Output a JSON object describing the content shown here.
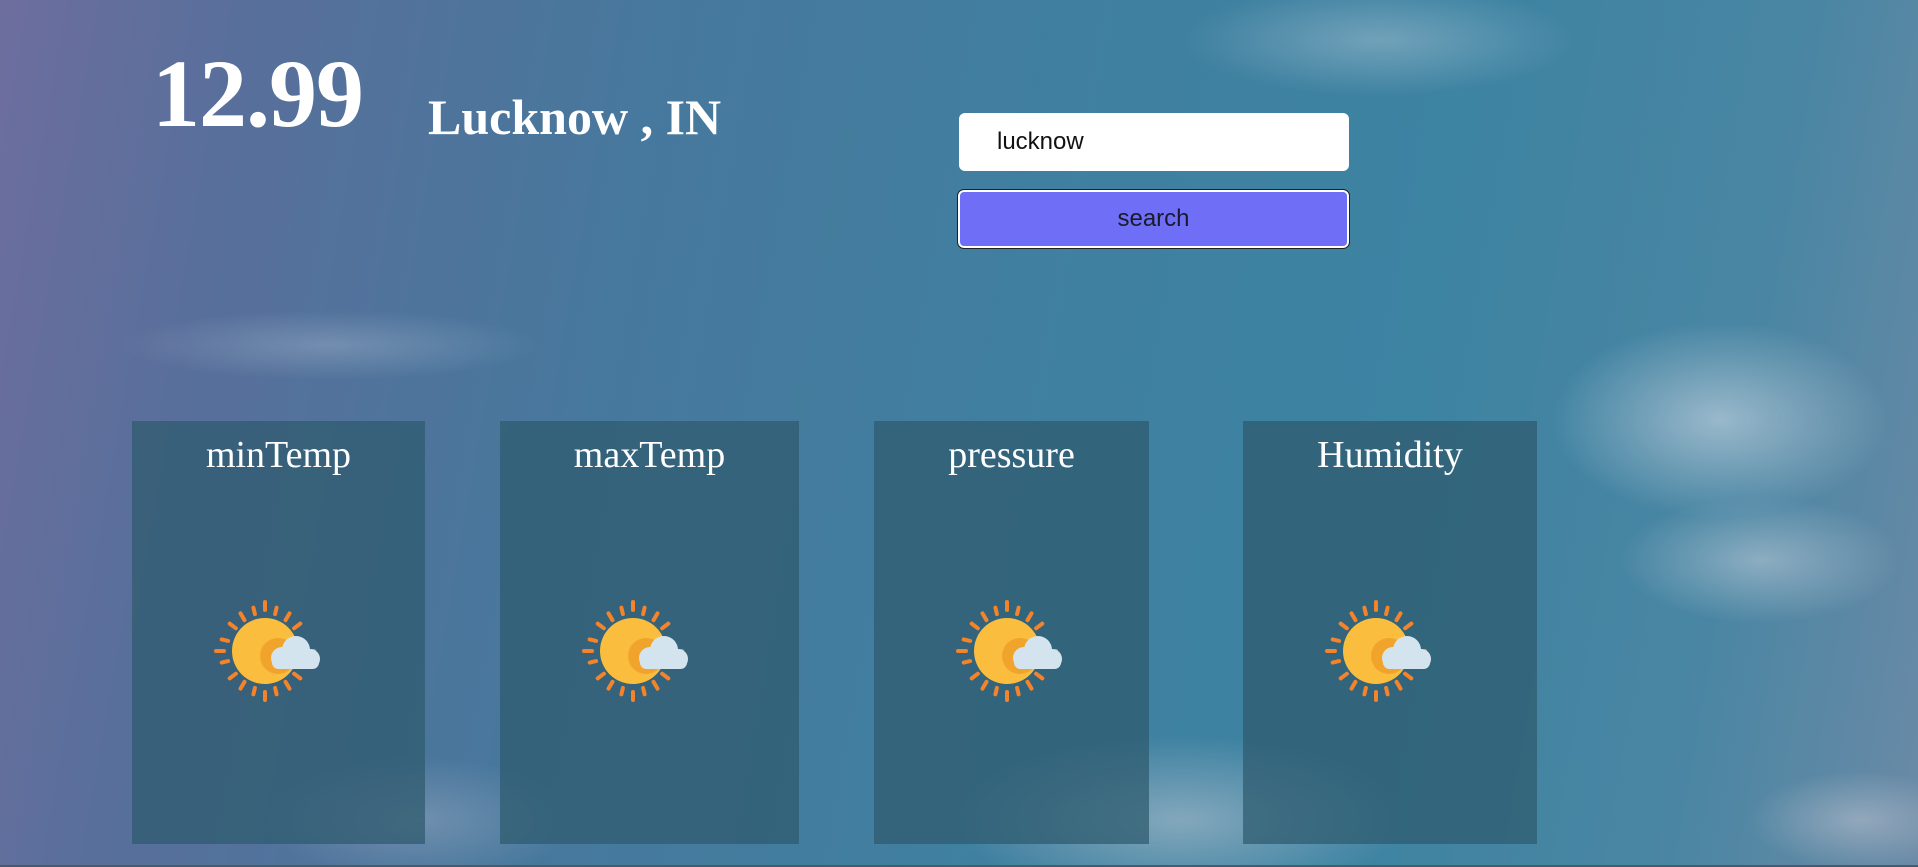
{
  "weather": {
    "temperature": "12.99",
    "location": "Lucknow , IN"
  },
  "search": {
    "value": "lucknow",
    "button_label": "search"
  },
  "cards": [
    {
      "label": "minTemp",
      "icon": "partly-sunny-icon"
    },
    {
      "label": "maxTemp",
      "icon": "partly-sunny-icon"
    },
    {
      "label": "pressure",
      "icon": "partly-sunny-icon"
    },
    {
      "label": "Humidity",
      "icon": "partly-sunny-icon"
    }
  ],
  "colors": {
    "button": "#6e6ff6",
    "card": "#2e5a6e",
    "sun": "#fbbd3e",
    "rays": "#f4832a",
    "cloud": "#d4e4ee"
  }
}
